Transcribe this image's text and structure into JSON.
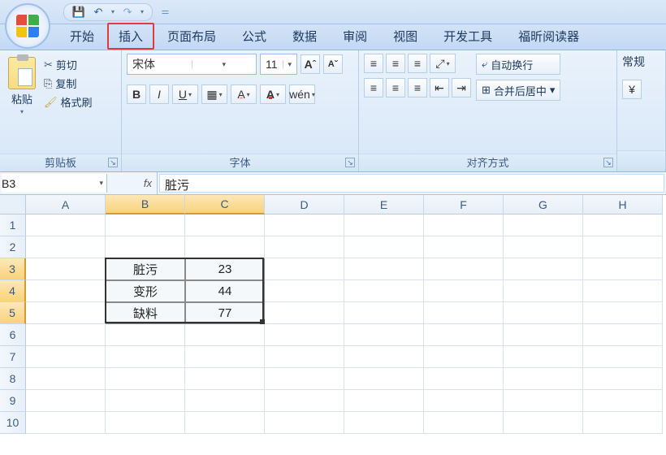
{
  "qat": {
    "save": "save",
    "undo": "undo",
    "redo": "redo"
  },
  "tabs": [
    "开始",
    "插入",
    "页面布局",
    "公式",
    "数据",
    "审阅",
    "视图",
    "开发工具",
    "福昕阅读器"
  ],
  "highlighted_tab_index": 1,
  "clipboard": {
    "paste": "粘贴",
    "cut": "剪切",
    "copy": "复制",
    "format_painter": "格式刷",
    "group": "剪贴板"
  },
  "font": {
    "name": "宋体",
    "size": "11",
    "group": "字体",
    "bold": "B",
    "italic": "I",
    "underline": "U"
  },
  "alignment": {
    "wrap": "自动换行",
    "merge": "合并后居中",
    "group": "对齐方式"
  },
  "number": {
    "general": "常规"
  },
  "name_box": "B3",
  "formula_value": "脏污",
  "columns": [
    "A",
    "B",
    "C",
    "D",
    "E",
    "F",
    "G",
    "H"
  ],
  "rows": [
    "1",
    "2",
    "3",
    "4",
    "5",
    "6",
    "7",
    "8",
    "9",
    "10"
  ],
  "selected_cols": [
    "B",
    "C"
  ],
  "selected_rows": [
    "3",
    "4",
    "5"
  ],
  "cells": {
    "B3": "脏污",
    "C3": "23",
    "B4": "变形",
    "C4": "44",
    "B5": "缺料",
    "C5": "77"
  },
  "chart_data": {
    "type": "table",
    "categories": [
      "脏污",
      "变形",
      "缺料"
    ],
    "values": [
      23,
      44,
      77
    ]
  }
}
